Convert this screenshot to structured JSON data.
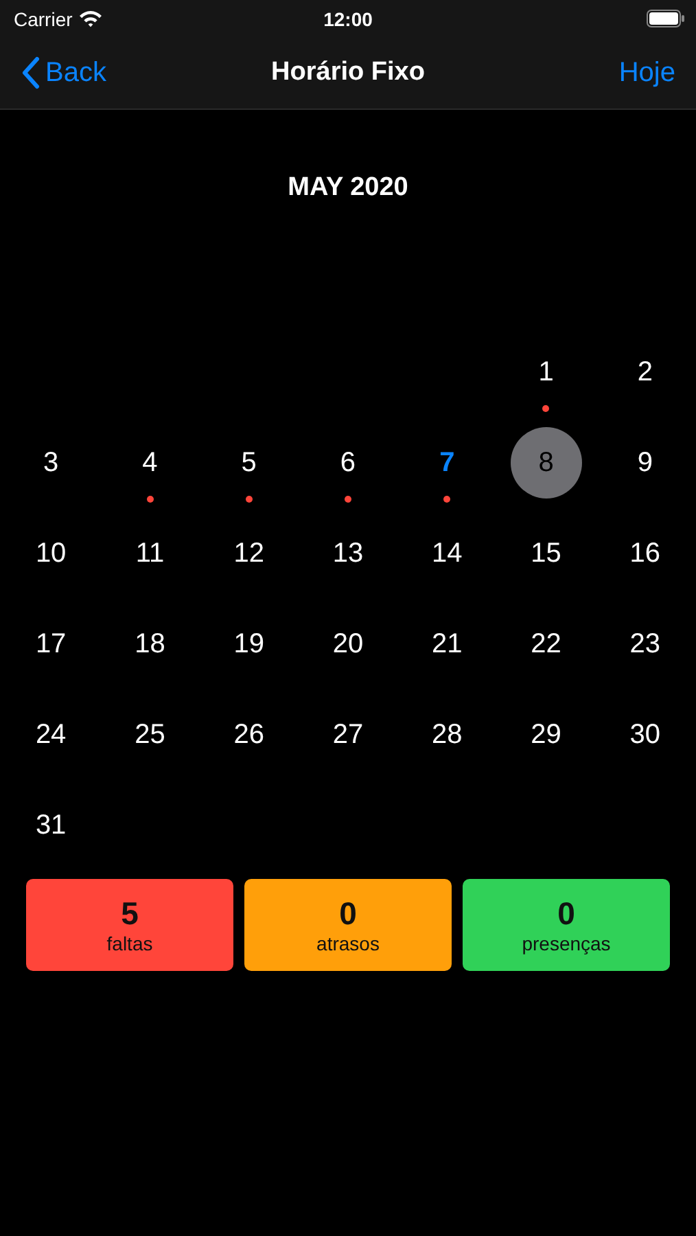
{
  "status_bar": {
    "carrier": "Carrier",
    "time": "12:00"
  },
  "nav": {
    "back": "Back",
    "title": "Horário Fixo",
    "action": "Hoje"
  },
  "calendar": {
    "month": "MAY 2020",
    "days": [
      {
        "kind": "blank"
      },
      {
        "kind": "blank"
      },
      {
        "kind": "blank"
      },
      {
        "kind": "blank"
      },
      {
        "kind": "blank"
      },
      {
        "day": "1",
        "selected": false,
        "today": false,
        "marked": true
      },
      {
        "day": "2",
        "selected": false,
        "today": false,
        "marked": false
      },
      {
        "day": "3",
        "selected": false,
        "today": false,
        "marked": false
      },
      {
        "day": "4",
        "selected": false,
        "today": false,
        "marked": true
      },
      {
        "day": "5",
        "selected": false,
        "today": false,
        "marked": true
      },
      {
        "day": "6",
        "selected": false,
        "today": false,
        "marked": true
      },
      {
        "day": "7",
        "selected": false,
        "today": true,
        "marked": true
      },
      {
        "day": "8",
        "selected": true,
        "today": false,
        "marked": false
      },
      {
        "day": "9",
        "selected": false,
        "today": false,
        "marked": false
      },
      {
        "day": "10",
        "selected": false,
        "today": false,
        "marked": false
      },
      {
        "day": "11",
        "selected": false,
        "today": false,
        "marked": false
      },
      {
        "day": "12",
        "selected": false,
        "today": false,
        "marked": false
      },
      {
        "day": "13",
        "selected": false,
        "today": false,
        "marked": false
      },
      {
        "day": "14",
        "selected": false,
        "today": false,
        "marked": false
      },
      {
        "day": "15",
        "selected": false,
        "today": false,
        "marked": false
      },
      {
        "day": "16",
        "selected": false,
        "today": false,
        "marked": false
      },
      {
        "day": "17",
        "selected": false,
        "today": false,
        "marked": false
      },
      {
        "day": "18",
        "selected": false,
        "today": false,
        "marked": false
      },
      {
        "day": "19",
        "selected": false,
        "today": false,
        "marked": false
      },
      {
        "day": "20",
        "selected": false,
        "today": false,
        "marked": false
      },
      {
        "day": "21",
        "selected": false,
        "today": false,
        "marked": false
      },
      {
        "day": "22",
        "selected": false,
        "today": false,
        "marked": false
      },
      {
        "day": "23",
        "selected": false,
        "today": false,
        "marked": false
      },
      {
        "day": "24",
        "selected": false,
        "today": false,
        "marked": false
      },
      {
        "day": "25",
        "selected": false,
        "today": false,
        "marked": false
      },
      {
        "day": "26",
        "selected": false,
        "today": false,
        "marked": false
      },
      {
        "day": "27",
        "selected": false,
        "today": false,
        "marked": false
      },
      {
        "day": "28",
        "selected": false,
        "today": false,
        "marked": false
      },
      {
        "day": "29",
        "selected": false,
        "today": false,
        "marked": false
      },
      {
        "day": "30",
        "selected": false,
        "today": false,
        "marked": false
      },
      {
        "day": "31",
        "selected": false,
        "today": false,
        "marked": false
      }
    ]
  },
  "summary": [
    {
      "count": "5",
      "label": "faltas",
      "color": "#ff453a"
    },
    {
      "count": "0",
      "label": "atrasos",
      "color": "#ff9f0a"
    },
    {
      "count": "0",
      "label": "presenças",
      "color": "#30d158"
    }
  ]
}
